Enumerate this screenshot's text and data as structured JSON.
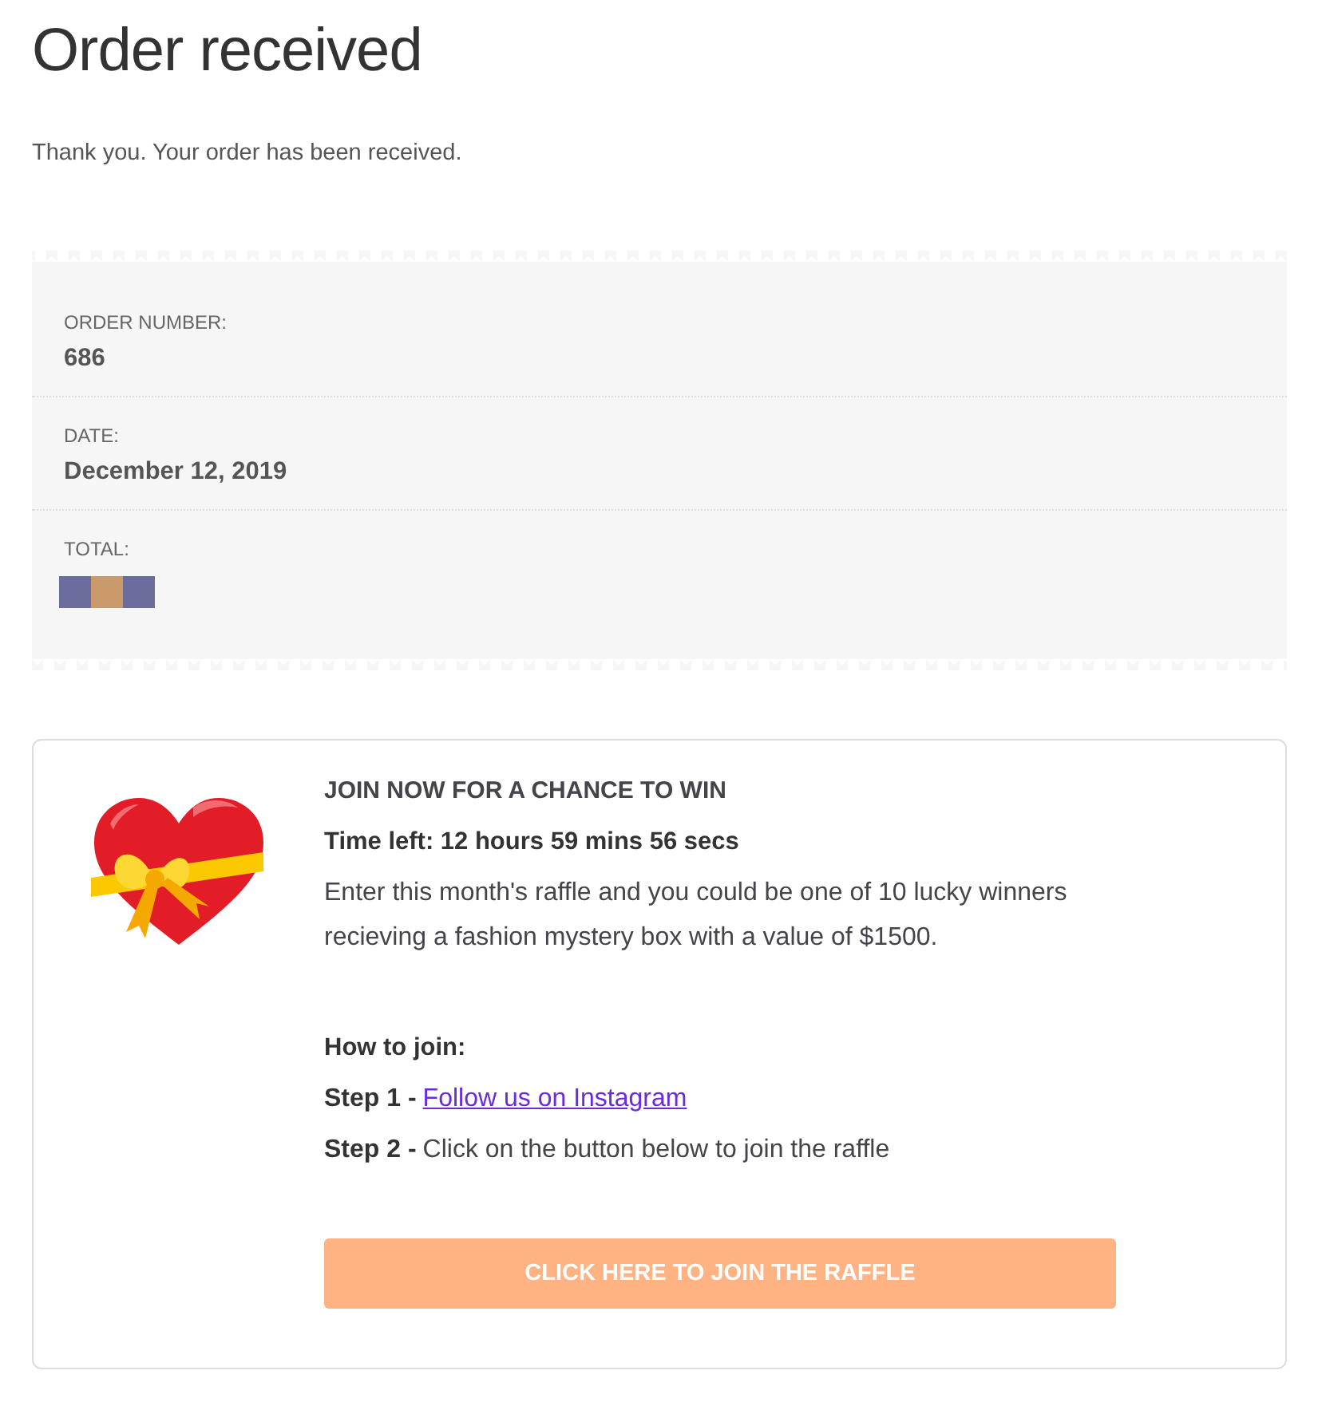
{
  "title": "Order received",
  "notice": "Thank you. Your order has been received.",
  "order_details": [
    {
      "label": "ORDER NUMBER:",
      "value": "686",
      "kind": "text"
    },
    {
      "label": "DATE:",
      "value": "December 12, 2019",
      "kind": "text"
    },
    {
      "label": "TOTAL:",
      "kind": "hidden"
    }
  ],
  "raffle": {
    "heading": "JOIN NOW FOR A CHANCE TO WIN",
    "timer": "Time left: 12 hours 59 mins 56 secs",
    "description": "Enter this month's raffle and you could be one of 10 lucky winners recieving a fashion mystery box with a value of $1500.",
    "how_to": "How to join:",
    "steps": [
      {
        "label": "Step 1 -",
        "text": "Follow us on Instagram",
        "kind": "link"
      },
      {
        "label": "Step 2 -",
        "text": "Click on the button below to join the raffle",
        "kind": "text"
      }
    ],
    "button": "CLICK HERE TO JOIN THE RAFFLE"
  }
}
